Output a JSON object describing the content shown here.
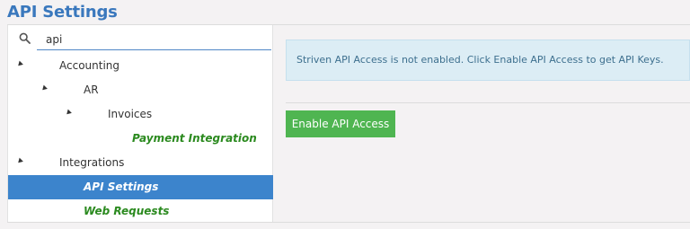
{
  "page": {
    "title": "API Settings"
  },
  "search": {
    "value": "api",
    "icon": "search-icon"
  },
  "tree": {
    "items": [
      {
        "label": "Accounting",
        "expanded": true
      },
      {
        "label": "AR",
        "expanded": true
      },
      {
        "label": "Invoices",
        "expanded": true
      },
      {
        "label": "Payment Integration",
        "link": true
      },
      {
        "label": "Integrations",
        "expanded": true
      },
      {
        "label": "API Settings",
        "link": true,
        "selected": true
      },
      {
        "label": "Web Requests",
        "link": true
      }
    ]
  },
  "main": {
    "info_message": "Striven API Access is not enabled. Click Enable API Access to get API Keys.",
    "enable_button_label": "Enable API Access"
  },
  "colors": {
    "title": "#3a78bd",
    "link_green": "#2b8a1f",
    "selected_bg": "#3c84cc",
    "button_green": "#4fb551",
    "info_bg": "#dcedf5"
  }
}
